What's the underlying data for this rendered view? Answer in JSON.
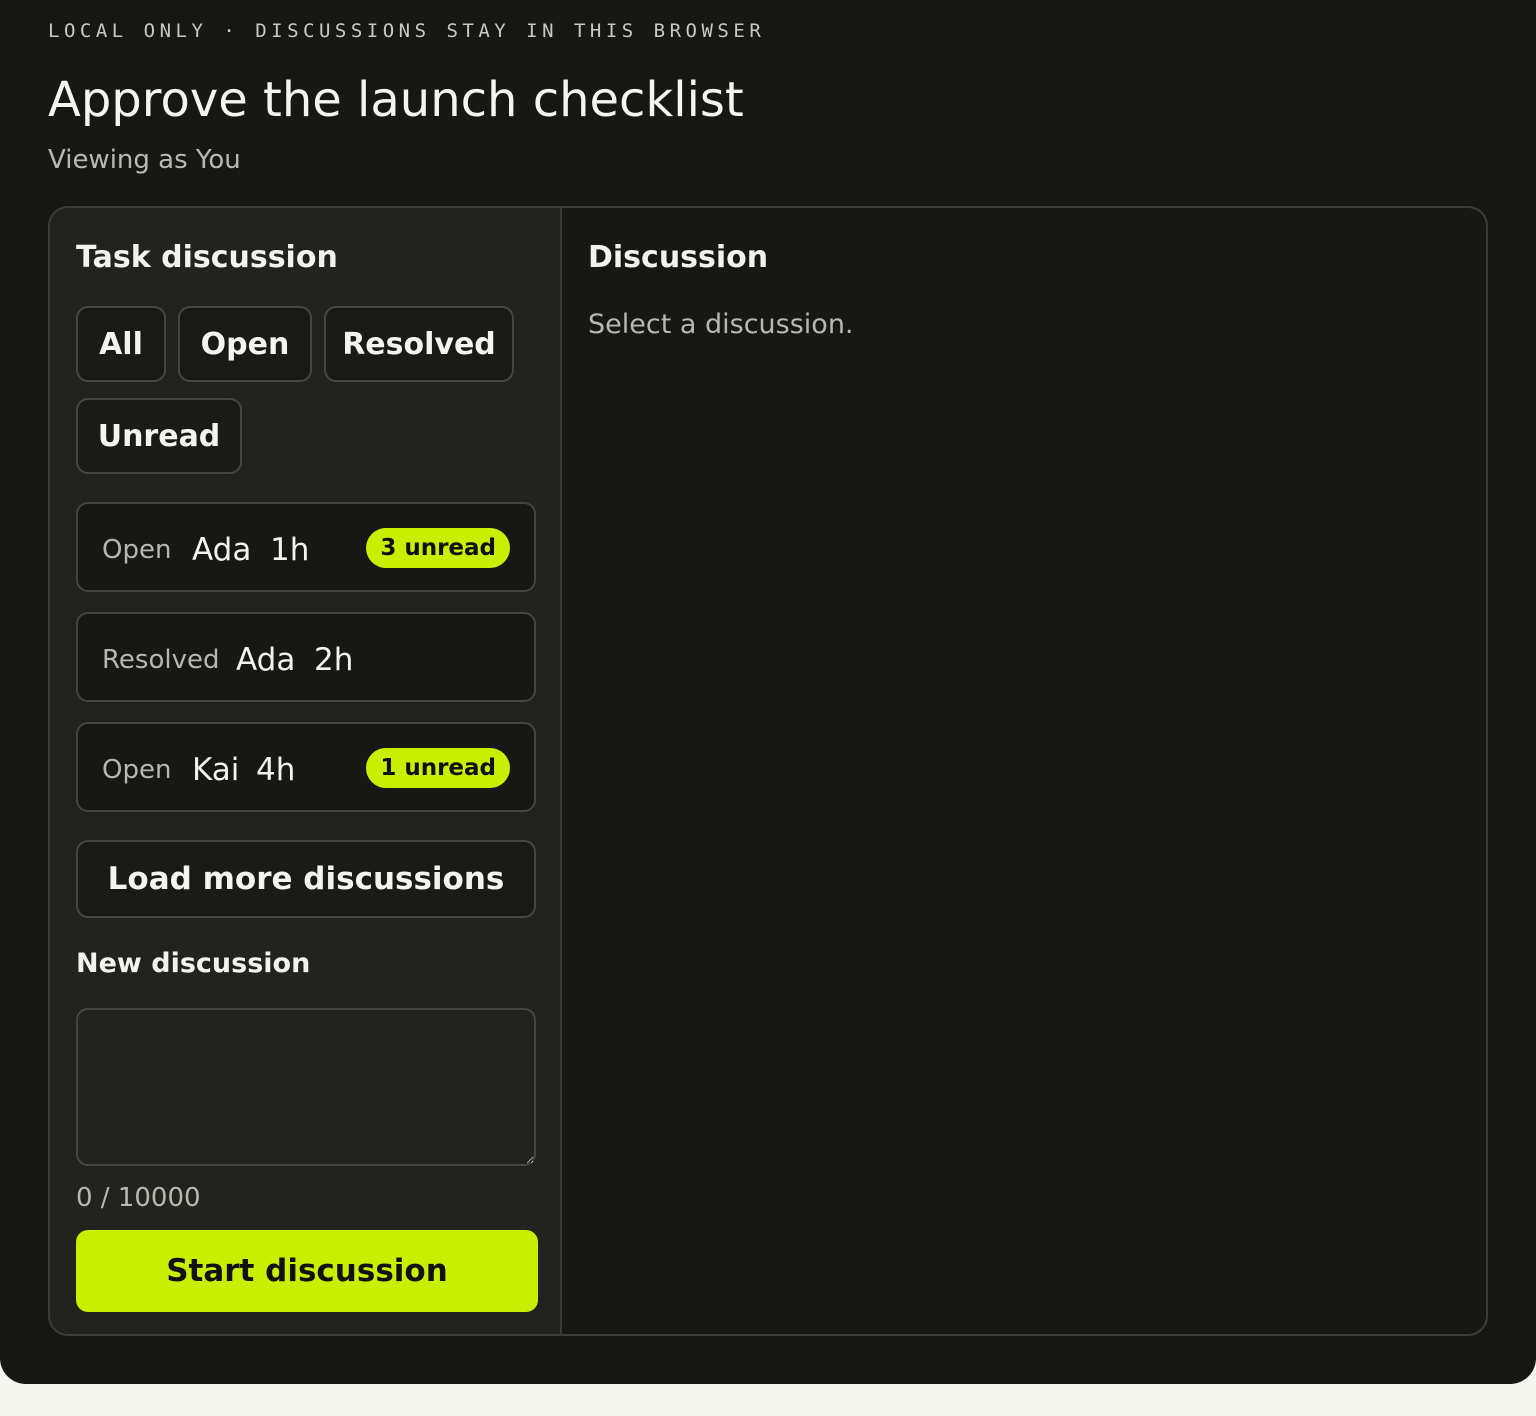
{
  "header": {
    "eyebrow": "LOCAL ONLY · DISCUSSIONS STAY IN THIS BROWSER",
    "title": "Approve the launch checklist",
    "subtitle": "Viewing as You"
  },
  "sidebar": {
    "title": "Task discussion",
    "filters": [
      {
        "label": "All"
      },
      {
        "label": "Open"
      },
      {
        "label": "Resolved"
      },
      {
        "label": "Unread"
      }
    ],
    "threads": [
      {
        "status": "Open",
        "author": "Ada",
        "time": "1h",
        "badge": "3 unread"
      },
      {
        "status": "Resolved",
        "author": "Ada",
        "time": "2h",
        "badge": ""
      },
      {
        "status": "Open",
        "author": "Kai",
        "time": "4h",
        "badge": "1 unread"
      }
    ],
    "load_more_label": "Load more discussions",
    "new_discussion": {
      "label": "New discussion",
      "value": "",
      "placeholder": "",
      "char_count": "0 / 10000",
      "submit_label": "Start discussion"
    }
  },
  "detail": {
    "title": "Discussion",
    "empty_text": "Select a discussion."
  },
  "colors": {
    "background": "#171816",
    "sidebar": "#22231e",
    "accent": "#c9ef00",
    "border": "#44453d",
    "page": "#f4f5ef"
  }
}
